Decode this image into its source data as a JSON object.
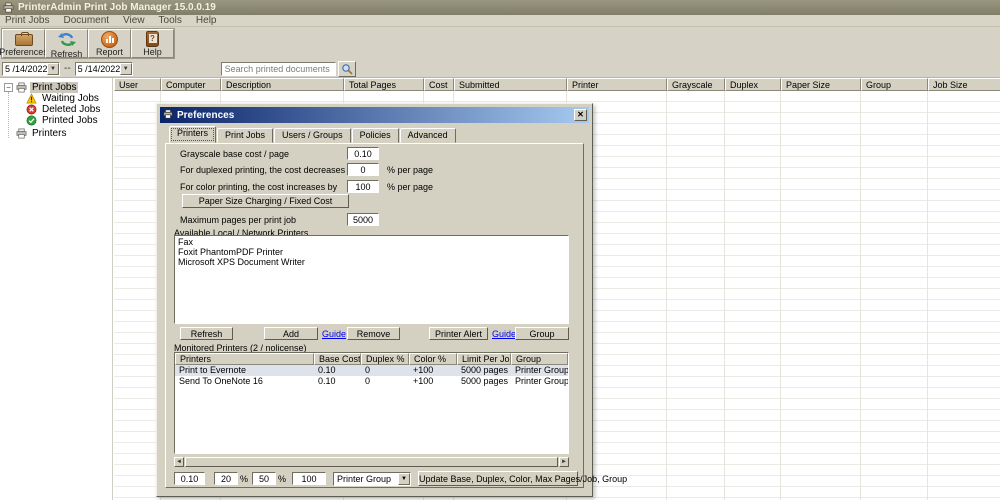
{
  "window": {
    "title": "PrinterAdmin Print Job Manager 15.0.0.19"
  },
  "menu": {
    "items": [
      {
        "label": "Print Jobs"
      },
      {
        "label": "Document"
      },
      {
        "label": "View"
      },
      {
        "label": "Tools"
      },
      {
        "label": "Help"
      }
    ]
  },
  "toolbar": {
    "buttons": [
      {
        "label": "Preferences"
      },
      {
        "label": "Refresh"
      },
      {
        "label": "Report"
      },
      {
        "label": "Help"
      }
    ]
  },
  "filterbar": {
    "date_from": "5 /14/2022",
    "separator": "--",
    "date_to": "5 /14/2022",
    "search_placeholder": "Search printed documents"
  },
  "tree": {
    "items": [
      {
        "label": "Print Jobs"
      },
      {
        "label": "Waiting Jobs"
      },
      {
        "label": "Deleted Jobs"
      },
      {
        "label": "Printed Jobs"
      },
      {
        "label": "Printers"
      }
    ]
  },
  "grid": {
    "columns": [
      "User",
      "Computer",
      "Description",
      "Total Pages",
      "Cost",
      "Submitted",
      "Printer",
      "Grayscale",
      "Duplex",
      "Paper Size",
      "Group",
      "Job Size"
    ]
  },
  "dialog": {
    "title": "Preferences",
    "tabs": [
      "Printers",
      "Print Jobs",
      "Users / Groups",
      "Policies",
      "Advanced"
    ],
    "fields": {
      "grayscale_label": "Grayscale base cost / page",
      "grayscale_value": "0.10",
      "duplex_label": "For duplexed printing, the cost decreases by",
      "duplex_value": "0",
      "duplex_suffix": "% per page",
      "color_label": "For color printing, the cost increases by",
      "color_value": "100",
      "color_suffix": "% per page",
      "paper_size_button": "Paper Size Charging / Fixed Cost",
      "max_pages_label": "Maximum pages per print job",
      "max_pages_value": "5000"
    },
    "available_printers": {
      "label": "Available Local / Network Printers",
      "items": [
        "Fax",
        "Foxit PhantomPDF Printer",
        "Microsoft XPS Document Writer"
      ]
    },
    "actions": {
      "refresh": "Refresh",
      "add": "Add",
      "guide1": "Guide",
      "remove": "Remove",
      "printer_alert": "Printer Alert",
      "guide2": "Guide",
      "group": "Group"
    },
    "monitored": {
      "label": "Monitored Printers (2 / nolicense)",
      "columns": [
        "Printers",
        "Base Cost",
        "Duplex %",
        "Color %",
        "Limit Per Job",
        "Group"
      ],
      "rows": [
        [
          "Print to Evernote",
          "0.10",
          "0",
          "+100",
          "5000 pages",
          "Printer Group"
        ],
        [
          "Send To OneNote 16",
          "0.10",
          "0",
          "+100",
          "5000 pages",
          "Printer Group"
        ]
      ]
    },
    "bottom": {
      "base": "0.10",
      "duplex": "20",
      "pct1": "%",
      "color": "50",
      "pct2": "%",
      "max": "100",
      "group_select": "Printer Group",
      "update_button": "Update Base, Duplex, Color, Max Pages/Job, Group"
    }
  },
  "colors": {
    "main_titlebar": "#8d8a74",
    "dialog_titlebar_start": "#0a246a",
    "dialog_titlebar_end": "#a6caf0",
    "chrome": "#d4d1c2",
    "link": "#0000ee",
    "waiting_warning": "#f6c500",
    "deleted_red": "#d93a2e",
    "printed_green": "#2fa33c",
    "report_orange": "#d06a17"
  }
}
